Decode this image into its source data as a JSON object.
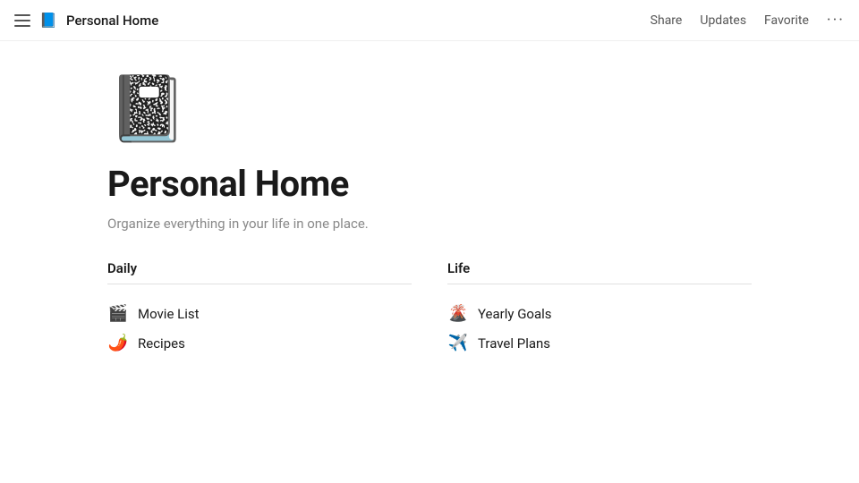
{
  "topbar": {
    "menu_icon_label": "menu",
    "page_icon": "📘",
    "title": "Personal Home",
    "actions": [
      {
        "label": "Share",
        "key": "share"
      },
      {
        "label": "Updates",
        "key": "updates"
      },
      {
        "label": "Favorite",
        "key": "favorite"
      },
      {
        "label": "···",
        "key": "more"
      }
    ]
  },
  "page": {
    "cover_emoji": "📓",
    "title": "Personal Home",
    "subtitle": "Organize everything in your life in one place."
  },
  "columns": [
    {
      "header": "Daily",
      "key": "daily",
      "items": [
        {
          "emoji": "🎬",
          "label": "Movie List"
        },
        {
          "emoji": "🌶️",
          "label": "Recipes"
        }
      ]
    },
    {
      "header": "Life",
      "key": "life",
      "items": [
        {
          "emoji": "🌋",
          "label": "Yearly Goals"
        },
        {
          "emoji": "✈️",
          "label": "Travel Plans"
        }
      ]
    }
  ]
}
